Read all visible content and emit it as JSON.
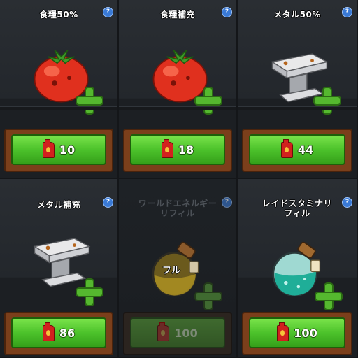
{
  "shop": {
    "items": [
      {
        "title": "食糧50%",
        "icon": "tomato-icon",
        "cost": "10",
        "cost_icon": "fuel-can-icon",
        "help": "?"
      },
      {
        "title": "食糧補充",
        "icon": "tomato-icon",
        "cost": "18",
        "cost_icon": "fuel-can-icon",
        "help": "?"
      },
      {
        "title": "メタル50%",
        "icon": "anvil-icon",
        "cost": "44",
        "cost_icon": "fuel-can-icon",
        "help": "?"
      },
      {
        "title": "メタル補充",
        "icon": "anvil-icon",
        "cost": "86",
        "cost_icon": "fuel-can-icon",
        "help": "?"
      },
      {
        "title": "ワールドエネルギー\nリフィル",
        "icon": "yellow-potion-icon",
        "cost": "100",
        "cost_icon": "fuel-can-icon",
        "status": "フル",
        "help": "?"
      },
      {
        "title": "レイドスタミナリ\nフィル",
        "icon": "teal-potion-icon",
        "cost": "100",
        "cost_icon": "fuel-can-icon",
        "help": "?"
      }
    ]
  },
  "colors": {
    "button_green": "#4cc22b",
    "plus_green": "#55b82f",
    "frame_brown": "#7b3f1b",
    "fuel_red": "#d2211e"
  }
}
